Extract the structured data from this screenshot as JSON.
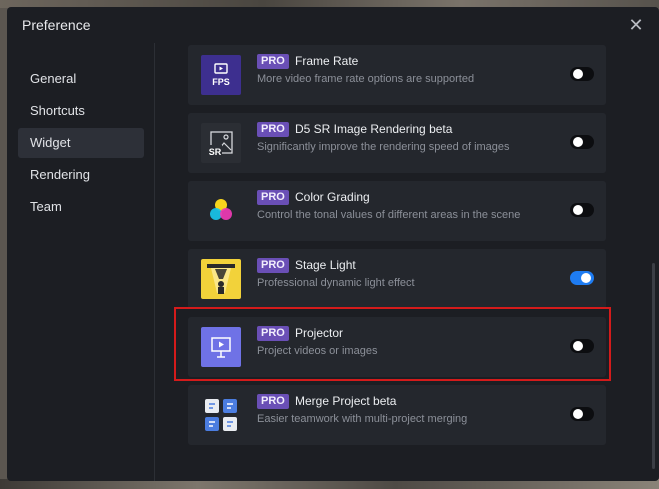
{
  "window": {
    "title": "Preference"
  },
  "sidebar": {
    "items": [
      {
        "label": "General"
      },
      {
        "label": "Shortcuts"
      },
      {
        "label": "Widget",
        "active": true
      },
      {
        "label": "Rendering"
      },
      {
        "label": "Team"
      }
    ]
  },
  "widgets": [
    {
      "badge": "PRO",
      "title": "Frame Rate",
      "description": "More video frame rate options are supported",
      "enabled": false,
      "icon": "fps-icon",
      "icon_text": "FPS",
      "icon_color": "#3d2f8f"
    },
    {
      "badge": "PRO",
      "title": "D5 SR Image Rendering beta",
      "description": "Significantly improve the rendering speed of images",
      "enabled": false,
      "icon": "sr-image-icon",
      "icon_text": "SR",
      "icon_color": "#2b2e34"
    },
    {
      "badge": "PRO",
      "title": "Color Grading",
      "description": "Control the tonal values of different areas in the scene",
      "enabled": false,
      "icon": "color-grading-icon",
      "icon_color": "#24272d"
    },
    {
      "badge": "PRO",
      "title": "Stage Light",
      "description": "Professional dynamic light effect",
      "enabled": true,
      "icon": "stage-light-icon",
      "icon_color": "#f2d23a"
    },
    {
      "badge": "PRO",
      "title": "Projector",
      "description": "Project videos or images",
      "enabled": false,
      "icon": "projector-icon",
      "icon_color": "#6f72e6"
    },
    {
      "badge": "PRO",
      "title": "Merge Project beta",
      "description": "Easier teamwork with multi-project merging",
      "enabled": false,
      "icon": "merge-project-icon",
      "icon_color": "#24272d"
    }
  ],
  "colors": {
    "accent": "#1e7cf2",
    "pro_badge": "#6a4fb6",
    "highlight": "#d41b1b"
  }
}
